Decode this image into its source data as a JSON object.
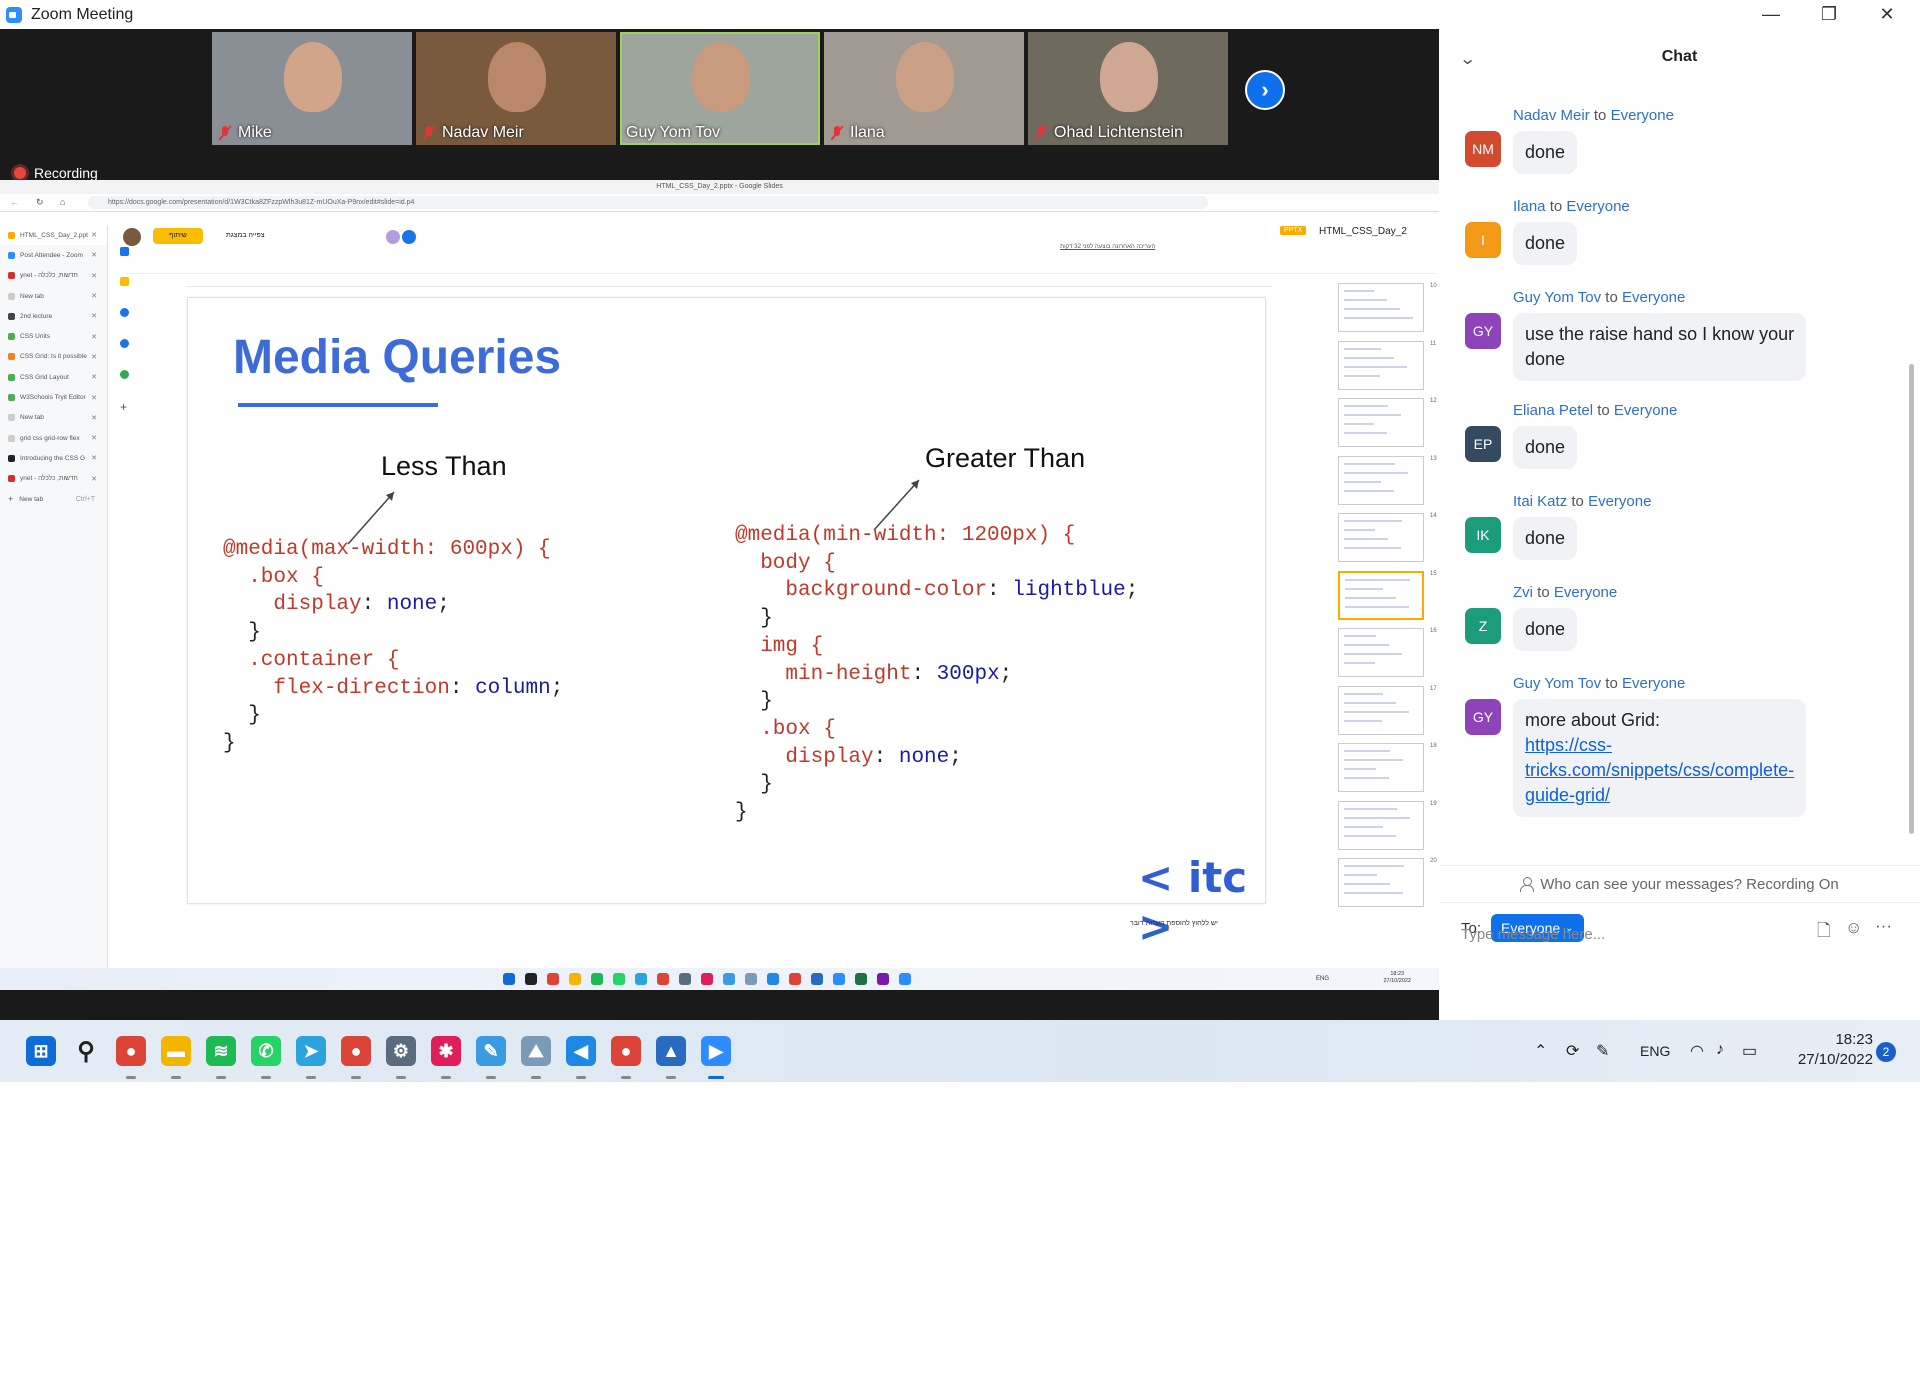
{
  "window": {
    "title": "Zoom Meeting",
    "minimize": "—",
    "restore": "❐",
    "close": "✕"
  },
  "participants": [
    {
      "name": "Mike",
      "muted": true,
      "bg": "#8a8f96",
      "face": "#d2a58a"
    },
    {
      "name": "Nadav Meir",
      "muted": true,
      "bg": "#7a5a3d",
      "face": "#b9876a"
    },
    {
      "name": "Guy Yom Tov",
      "muted": false,
      "active": true,
      "bg": "#9ea59c",
      "face": "#c89a7e"
    },
    {
      "name": "Ilana",
      "muted": true,
      "bg": "#a09a92",
      "face": "#caa086"
    },
    {
      "name": "Ohad Lichtenstein",
      "muted": true,
      "bg": "#6f6a5e",
      "face": "#d0a792"
    }
  ],
  "recording_label": "Recording",
  "next_icon": "›",
  "browser": {
    "window_title": "HTML_CSS_Day_2.pptx - Google Slides",
    "url": "https://docs.google.com/presentation/d/1W3Ctka8ZFzzpWlh3u81Z-mUOuXa-P9nx/edit#slide=id.p4",
    "tabs": [
      {
        "label": "HTML_CSS_Day_2.ppt",
        "color": "#f9ab00",
        "selected": true
      },
      {
        "label": "Post Attendee - Zoom",
        "color": "#2d8cff"
      },
      {
        "label": "ynet - חדשות, כלכלה",
        "color": "#d92c2c"
      },
      {
        "label": "New tab",
        "color": "#cccccc"
      },
      {
        "label": "2nd lecture",
        "color": "#444444"
      },
      {
        "label": "CSS Units",
        "color": "#4caf50"
      },
      {
        "label": "CSS Grid: Is it possible",
        "color": "#f48024"
      },
      {
        "label": "CSS Grid Layout",
        "color": "#4caf50"
      },
      {
        "label": "W3Schools Tryit Editor",
        "color": "#4caf50"
      },
      {
        "label": "New tab",
        "color": "#cccccc"
      },
      {
        "label": "grid css grid-row flex",
        "color": "#cccccc"
      },
      {
        "label": "Introducing the CSS G",
        "color": "#222222"
      },
      {
        "label": "ynet - חדשות, כלכלה",
        "color": "#d92c2c"
      }
    ],
    "new_tab_label": "New tab",
    "new_tab_shortcut": "Ctrl+T"
  },
  "docs": {
    "file_title": "HTML_CSS_Day_2",
    "badge": "PPTX",
    "share_label": "שיתוף",
    "present_label": "צפייה במצגת",
    "last_edit": "העריכה האחרונה בוצעה לפני 32 דקות",
    "speaker_notes": "יש ללחוץ להוספת הערות דובר"
  },
  "slide": {
    "title": "Media Queries",
    "label_left": "Less Than",
    "label_right": "Greater Than",
    "logo": "< itc >"
  },
  "code_left": [
    [
      {
        "t": "@media(max-width: 600px) {",
        "c": "sel"
      }
    ],
    [
      {
        "t": "  .box {",
        "c": "sel"
      }
    ],
    [
      {
        "t": "    display",
        "c": "prop"
      },
      {
        "t": ": ",
        "c": ""
      },
      {
        "t": "none",
        "c": "val"
      },
      {
        "t": ";",
        "c": ""
      }
    ],
    [
      {
        "t": "  }",
        "c": ""
      }
    ],
    [
      {
        "t": "  .container {",
        "c": "sel"
      }
    ],
    [
      {
        "t": "    flex-direction",
        "c": "prop"
      },
      {
        "t": ": ",
        "c": ""
      },
      {
        "t": "column",
        "c": "val"
      },
      {
        "t": ";",
        "c": ""
      }
    ],
    [
      {
        "t": "  }",
        "c": ""
      }
    ],
    [
      {
        "t": "}",
        "c": ""
      }
    ]
  ],
  "code_right": [
    [
      {
        "t": "@media(min-width: 1200px) {",
        "c": "sel"
      }
    ],
    [
      {
        "t": "  body {",
        "c": "sel"
      }
    ],
    [
      {
        "t": "    background-color",
        "c": "prop"
      },
      {
        "t": ": ",
        "c": ""
      },
      {
        "t": "lightblue",
        "c": "val"
      },
      {
        "t": ";",
        "c": ""
      }
    ],
    [
      {
        "t": "  }",
        "c": ""
      }
    ],
    [
      {
        "t": "  img {",
        "c": "sel"
      }
    ],
    [
      {
        "t": "    min-height",
        "c": "prop"
      },
      {
        "t": ": ",
        "c": ""
      },
      {
        "t": "300px",
        "c": "val"
      },
      {
        "t": ";",
        "c": ""
      }
    ],
    [
      {
        "t": "  }",
        "c": ""
      }
    ],
    [
      {
        "t": "  .box {",
        "c": "sel"
      }
    ],
    [
      {
        "t": "    display",
        "c": "prop"
      },
      {
        "t": ": ",
        "c": ""
      },
      {
        "t": "none",
        "c": "val"
      },
      {
        "t": ";",
        "c": ""
      }
    ],
    [
      {
        "t": "  }",
        "c": ""
      }
    ],
    [
      {
        "t": "}",
        "c": ""
      }
    ]
  ],
  "thumbnails": [
    {
      "num": "10"
    },
    {
      "num": "11"
    },
    {
      "num": "12"
    },
    {
      "num": "13"
    },
    {
      "num": "14"
    },
    {
      "num": "15",
      "active": true
    },
    {
      "num": "16"
    },
    {
      "num": "17"
    },
    {
      "num": "18"
    },
    {
      "num": "19"
    },
    {
      "num": "20"
    }
  ],
  "inner_clock": {
    "time": "18:23",
    "date": "27/10/2022",
    "lang": "ENG"
  },
  "chat": {
    "title": "Chat",
    "collapse_icon": "⌄",
    "to_word": "to",
    "messages": [
      {
        "from": "Nadav Meir",
        "to": "Everyone",
        "initials": "NM",
        "avatar_color": "#d24b2f",
        "text": "done"
      },
      {
        "from": "Ilana",
        "to": "Everyone",
        "initials": "I",
        "avatar_color": "#f29a18",
        "text": "done"
      },
      {
        "from": "Guy Yom Tov",
        "to": "Everyone",
        "initials": "GY",
        "avatar_color": "#8c44b8",
        "text_lines": [
          "use the raise hand so I know your",
          "done"
        ]
      },
      {
        "from": "Eliana Petel",
        "to": "Everyone",
        "initials": "EP",
        "avatar_color": "#344a60",
        "text": "done"
      },
      {
        "from": "Itai Katz",
        "to": "Everyone",
        "initials": "IK",
        "avatar_color": "#1b9d7c",
        "text": "done"
      },
      {
        "from": "Zvi",
        "to": "Everyone",
        "initials": "Z",
        "avatar_color": "#1b9d7c",
        "text": "done"
      },
      {
        "from": "Guy Yom Tov",
        "to": "Everyone",
        "initials": "GY",
        "avatar_color": "#8c44b8",
        "text": "more about Grid:",
        "link_lines": [
          "https://css-",
          "tricks.com/snippets/css/complete-",
          "guide-grid/"
        ]
      }
    ],
    "privacy_notice": "Who can see your messages? Recording On",
    "to_label": "To:",
    "to_value": "Everyone",
    "input_placeholder": "Type message here...",
    "file_icon": "🗋",
    "emoji_icon": "☺",
    "more_icon": "···"
  },
  "taskbar": {
    "icons": [
      {
        "name": "windows-start-icon",
        "glyph": "⊞",
        "color": "#0f6cd6"
      },
      {
        "name": "search-icon",
        "glyph": "⚲",
        "color": "#222222"
      },
      {
        "name": "chrome-icon",
        "glyph": "●",
        "color": "#db4437"
      },
      {
        "name": "file-explorer-icon",
        "glyph": "▬",
        "color": "#f4b400"
      },
      {
        "name": "spotify-icon",
        "glyph": "≋",
        "color": "#1db954"
      },
      {
        "name": "whatsapp-icon",
        "glyph": "✆",
        "color": "#25d366"
      },
      {
        "name": "telegram-icon",
        "glyph": "➤",
        "color": "#2aa3de"
      },
      {
        "name": "chrome-profile-icon",
        "glyph": "●",
        "color": "#db4437"
      },
      {
        "name": "settings-icon",
        "glyph": "⚙",
        "color": "#5a6b80"
      },
      {
        "name": "slack-icon",
        "glyph": "✱",
        "color": "#e01e5a"
      },
      {
        "name": "paint-icon",
        "glyph": "✎",
        "color": "#3a9be0"
      },
      {
        "name": "monitor-icon",
        "glyph": "⛰",
        "color": "#7a9ab8"
      },
      {
        "name": "vscode-icon",
        "glyph": "◀",
        "color": "#1e88e5"
      },
      {
        "name": "chrome-alt-icon",
        "glyph": "●",
        "color": "#db4437"
      },
      {
        "name": "photos-icon",
        "glyph": "▲",
        "color": "#2a6bc2"
      },
      {
        "name": "zoom-icon",
        "glyph": "▶",
        "color": "#2d8cff"
      }
    ],
    "lang": "ENG",
    "time": "18:23",
    "date": "27/10/2022",
    "notifications": "2"
  }
}
